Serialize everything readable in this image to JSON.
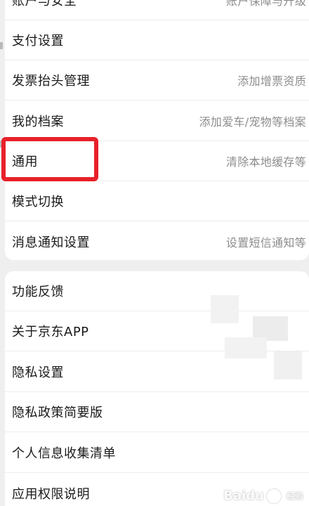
{
  "section1": {
    "items": [
      {
        "label": "账户与安全",
        "hint": "账户保障与升级"
      },
      {
        "label": "支付设置",
        "hint": ""
      },
      {
        "label": "发票抬头管理",
        "hint": "添加增票资质"
      },
      {
        "label": "我的档案",
        "hint": "添加爱车/宠物等档案"
      },
      {
        "label": "通用",
        "hint": "清除本地缓存等"
      },
      {
        "label": "模式切换",
        "hint": ""
      },
      {
        "label": "消息通知设置",
        "hint": "设置短信通知等"
      }
    ]
  },
  "section2": {
    "items": [
      {
        "label": "功能反馈",
        "hint": ""
      },
      {
        "label": "关于京东APP",
        "hint": ""
      },
      {
        "label": "隐私设置",
        "hint": ""
      },
      {
        "label": "隐私政策简要版",
        "hint": ""
      },
      {
        "label": "个人信息收集清单",
        "hint": ""
      },
      {
        "label": "应用权限说明",
        "hint": ""
      }
    ]
  },
  "annotation": {
    "color": "#e8202a",
    "target": "通用"
  },
  "watermark": {
    "text": "Baidu",
    "sub": "经验"
  }
}
